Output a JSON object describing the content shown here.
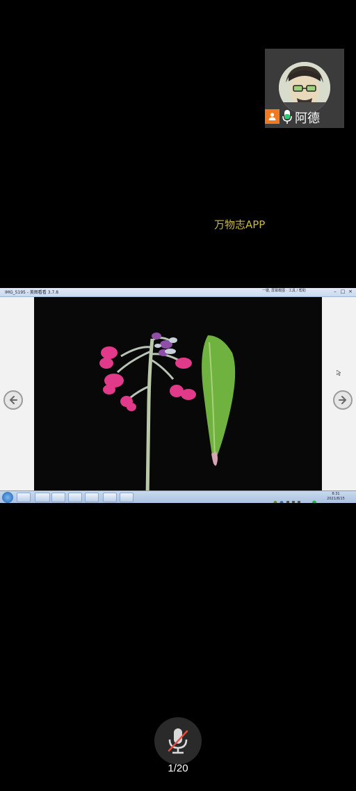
{
  "presenter": {
    "name": "阿德"
  },
  "watermark": {
    "text": "万物志APP"
  },
  "shared_screen": {
    "window_title": "IMG_5195 - 美图看看 3.7.8",
    "titlebar_right_text": "一键, 屏幕截图 · 工具 / 帮助",
    "taskbar_clock_time": "8:31",
    "taskbar_clock_date": "2021/8/15"
  },
  "pager": {
    "label": "1/20"
  },
  "colors": {
    "presenter_badge": "#f07a21",
    "mic_active": "#2ecc71",
    "mic_muted_slash": "#e74c3c",
    "watermark": "#c8b84a"
  }
}
